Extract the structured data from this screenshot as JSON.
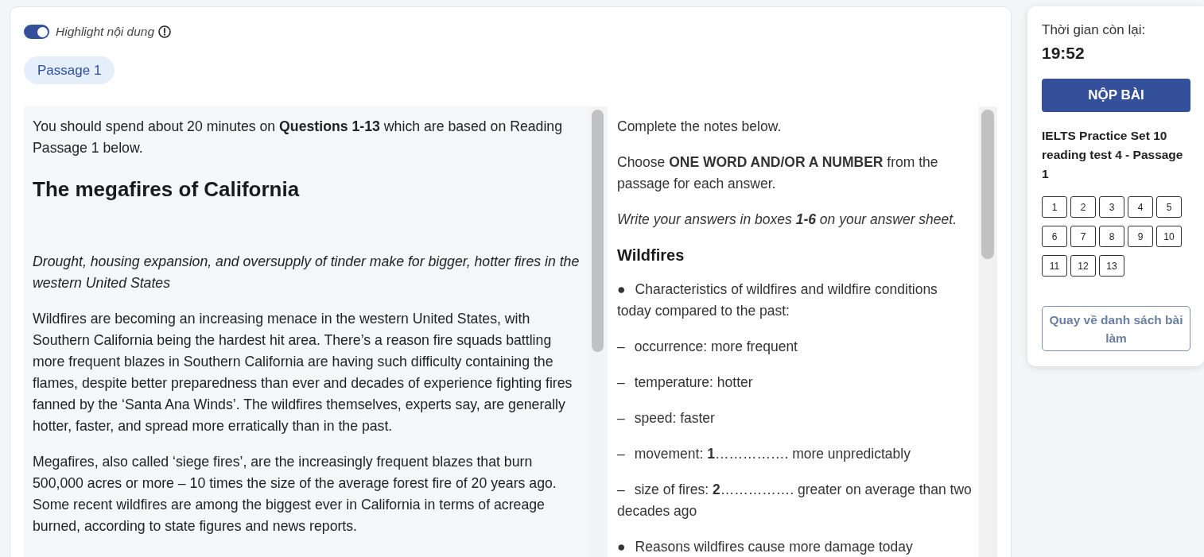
{
  "highlight_toggle": {
    "label": "Highlight nội dung",
    "on": true
  },
  "passage_tabs": [
    {
      "label": "Passage 1",
      "selected": true
    }
  ],
  "passage": {
    "intro": "You should spend about 20 minutes on **Questions 1-13** which are based on Reading Passage 1 below.",
    "title": "The megafires of California",
    "subtitle": "Drought, housing expansion, and oversupply of tinder make for bigger, hotter fires in the western United States",
    "paragraphs": [
      "Wildfires are becoming an increasing menace in the western United States, with Southern California being the hardest hit area. There’s a reason fire squads battling more frequent blazes in Southern California are having such difficulty containing the flames, despite better preparedness than ever and decades of experience fighting fires fanned by the ‘Santa Ana Winds’. The wildfires themselves, experts say, are generally hotter, faster, and spread more erratically than in the past.",
      "Megafires, also called ‘siege fires’, are the increasingly frequent blazes that burn 500,000 acres or more – 10 times the size of the average forest fire of 20 years ago. Some recent wildfires are among the biggest ever in California in terms of acreage burned, according to state figures and news reports."
    ]
  },
  "questions": [
    {
      "kind": "text",
      "text": "Complete the notes below."
    },
    {
      "kind": "text",
      "text": "Choose **ONE WORD AND/OR A NUMBER** from the passage for each answer."
    },
    {
      "kind": "note",
      "text": "Write your answers in boxes **1-6** on your answer sheet."
    },
    {
      "kind": "heading",
      "text": "Wildfires"
    },
    {
      "kind": "item",
      "marker": "●",
      "text": "Characteristics of wildfires and wildfire conditions today compared to the past:"
    },
    {
      "kind": "item",
      "marker": "–",
      "text": "occurrence: more frequent"
    },
    {
      "kind": "item",
      "marker": "–",
      "text": "temperature: hotter"
    },
    {
      "kind": "item",
      "marker": "–",
      "text": "speed: faster"
    },
    {
      "kind": "item",
      "marker": "–",
      "text": "movement: **1**……………. more unpredictably"
    },
    {
      "kind": "item",
      "marker": "–",
      "text": "size of fires: **2**……………. greater on average than two decades ago"
    },
    {
      "kind": "item",
      "marker": "●",
      "text": "Reasons wildfires cause more damage today"
    }
  ],
  "timer": {
    "label": "Thời gian còn lại:",
    "value": "19:52"
  },
  "submit_button": "NỘP BÀI",
  "test_title": "IELTS Practice Set 10 reading test 4 - Passage 1",
  "question_numbers": [
    "1",
    "2",
    "3",
    "4",
    "5",
    "6",
    "7",
    "8",
    "9",
    "10",
    "11",
    "12",
    "13"
  ],
  "back_button": "Quay về danh sách bài làm"
}
